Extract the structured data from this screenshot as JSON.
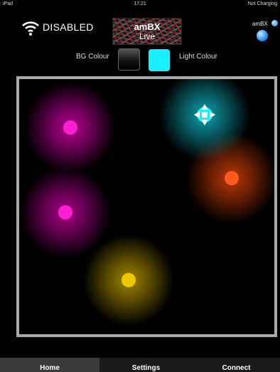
{
  "statusbar": {
    "device": "iPad",
    "time": "17:21",
    "battery": "Not Charging"
  },
  "header": {
    "wifi_status": "DISABLED",
    "logo_line1": "amBX",
    "logo_line2": "Live",
    "ambx_badge": "amBX"
  },
  "colour_bar": {
    "bg_label": "BG Colour",
    "light_label": "Light Colour",
    "bg_colour": "#000000",
    "light_colour": "#18f0ff"
  },
  "lights": [
    {
      "name": "light-1",
      "color": "#ff1fd0",
      "glow": "#c0009a"
    },
    {
      "name": "light-2",
      "color": "#ff5a1e",
      "glow": "#c43a08"
    },
    {
      "name": "light-3",
      "color": "#ff1fd0",
      "glow": "#b30090"
    },
    {
      "name": "light-4",
      "color": "#f0c800",
      "glow": "#a88d00"
    },
    {
      "name": "light-selected",
      "color": "#18f0ff",
      "glow": "#0ea8b4",
      "selected": true
    }
  ],
  "tabs": [
    {
      "label": "Home",
      "active": true
    },
    {
      "label": "Settings",
      "active": false
    },
    {
      "label": "Connect",
      "active": false
    }
  ]
}
